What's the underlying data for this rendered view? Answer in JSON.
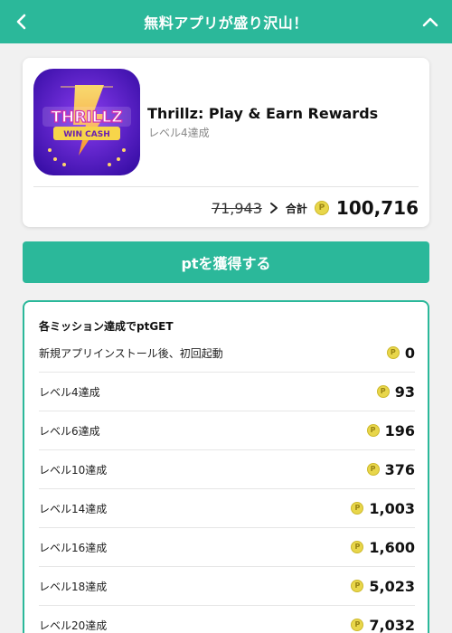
{
  "header": {
    "title": "無料アプリが盛り沢山！"
  },
  "app": {
    "icon_text_line1": "THRILLZ",
    "icon_text_line2": "WIN CASH",
    "name": "Thrillz: Play & Earn Rewards",
    "subtitle": "レベル4達成",
    "old_price": "71,943",
    "total_label": "合計",
    "total_value": "100,716"
  },
  "cta": {
    "label": "ptを獲得する"
  },
  "missions": {
    "header": "各ミッション達成でptGET",
    "items": [
      {
        "label": "新規アプリインストール後、初回起動",
        "points": "0"
      },
      {
        "label": "レベル4達成",
        "points": "93"
      },
      {
        "label": "レベル6達成",
        "points": "196"
      },
      {
        "label": "レベル10達成",
        "points": "376"
      },
      {
        "label": "レベル14達成",
        "points": "1,003"
      },
      {
        "label": "レベル16達成",
        "points": "1,600"
      },
      {
        "label": "レベル18達成",
        "points": "5,023"
      },
      {
        "label": "レベル20達成",
        "points": "7,032"
      }
    ]
  },
  "coin_symbol": "P",
  "colors": {
    "accent": "#2bb89a",
    "coin": "#e8d64a",
    "background": "#f1f1f1"
  },
  "icons": {
    "back": "chevron-left-icon",
    "collapse": "chevron-up-icon",
    "arrow": "chevron-right-icon",
    "coin": "coin-icon"
  }
}
